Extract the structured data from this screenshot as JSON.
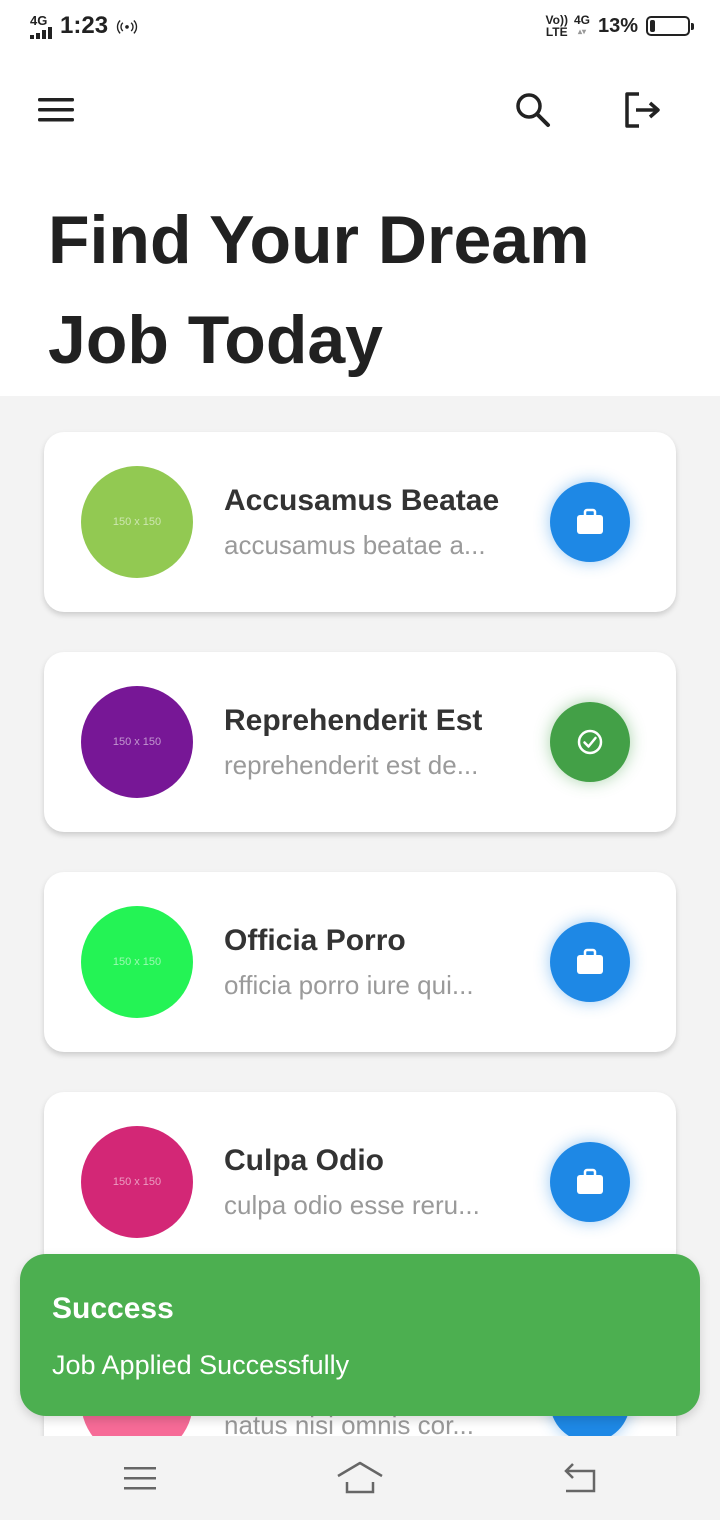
{
  "status_bar": {
    "network_label": "4G",
    "time": "1:23",
    "volte_top": "Vo))",
    "volte_bottom": "LTE",
    "net_type": "4G",
    "battery_text": "13%",
    "battery_level": 0.13
  },
  "app_bar": {
    "menu_icon": "hamburger-menu-icon",
    "search_icon": "search-icon",
    "logout_icon": "logout-icon"
  },
  "header": {
    "title": "Find Your Dream Job Today"
  },
  "jobs": [
    {
      "title": "Accusamus Beatae",
      "description": "accusamus beatae a...",
      "placeholder": "150 x 150",
      "avatar_color": "#92c952",
      "status": "apply"
    },
    {
      "title": "Reprehenderit Est",
      "description": "reprehenderit est de...",
      "placeholder": "150 x 150",
      "avatar_color": "#771796",
      "status": "applied"
    },
    {
      "title": "Officia Porro",
      "description": "officia porro iure qui...",
      "placeholder": "150 x 150",
      "avatar_color": "#24f355",
      "status": "apply"
    },
    {
      "title": "Culpa Odio",
      "description": "culpa odio esse reru...",
      "placeholder": "150 x 150",
      "avatar_color": "#d32776",
      "status": "apply"
    },
    {
      "title": "",
      "description": "natus nisi omnis cor...",
      "placeholder": "",
      "avatar_color": "#f66b97",
      "status": "apply"
    }
  ],
  "snackbar": {
    "title": "Success",
    "message": "Job Applied Successfully"
  },
  "colors": {
    "apply": "#1e88e5",
    "applied": "#43a047",
    "snackbar": "#4caf50"
  },
  "nav_bar": {
    "recents_icon": "recents-icon",
    "home_icon": "home-icon",
    "back_icon": "back-icon"
  }
}
